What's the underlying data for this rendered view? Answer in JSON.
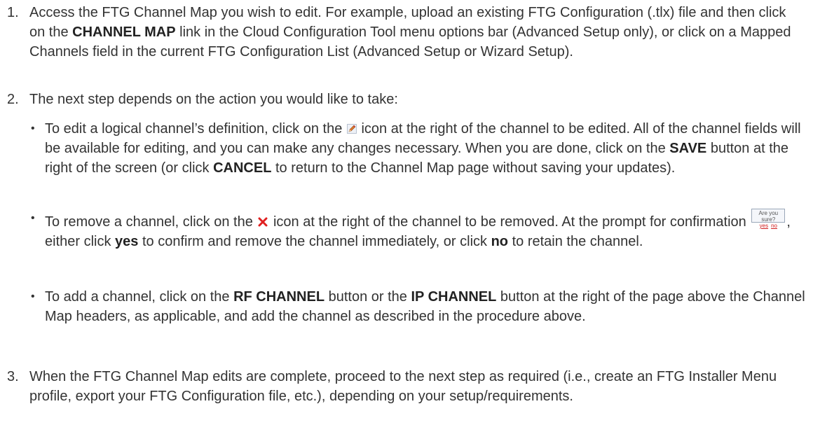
{
  "steps": [
    {
      "number": "1.",
      "parts": {
        "t1": "Access the FTG Channel Map you wish to edit. For example, upload an existing FTG Configuration (.tlx) file and then click on the ",
        "b1": "CHANNEL MAP",
        "t2": " link in the Cloud Configuration Tool menu options bar (Advanced Setup only), or click on a Mapped Channels field in the current FTG Configuration List (Advanced Setup or Wizard Setup)."
      }
    },
    {
      "number": "2.",
      "text": "The next step depends on the action you would like to take:"
    },
    {
      "number": "3.",
      "text": "When the FTG Channel Map edits are complete, proceed to the next step as required (i.e., create an FTG Installer Menu profile, export your FTG Configuration file, etc.), depending on your setup/requirements."
    }
  ],
  "bullets": {
    "dot": "•",
    "edit": {
      "t1": "To edit a logical channel’s definition, click on the ",
      "icon": "edit-pencil-icon",
      "t2": " icon at the right of the channel to be edited. All of the channel fields will be available for editing, and you can make any changes necessary. When you are done, click on the ",
      "b1": "SAVE",
      "t3": " button at the right of the screen (or click ",
      "b2": "CANCEL",
      "t4": " to return to the Channel Map page without saving your updates)."
    },
    "remove": {
      "t1": "To remove a channel, click on the ",
      "icon": "remove-x-icon",
      "t2": " icon at the right of the channel to be removed. At the prompt for confirmation ",
      "confirm": {
        "question": "Are you sure?",
        "yes": "yes",
        "no": "no"
      },
      "t3": ", either click ",
      "b1": "yes",
      "t4": " to confirm and remove the channel immediately, or click ",
      "b2": "no",
      "t5": " to retain the channel."
    },
    "add": {
      "t1": "To add a channel, click on the ",
      "b1": "RF CHANNEL",
      "t2": " button or the ",
      "b2": "IP CHANNEL",
      "t3": " button at the right of the page above the Channel Map headers, as applicable, and add the channel as described in the procedure above."
    }
  },
  "colors": {
    "text": "#333333",
    "link_red": "#d01c1c",
    "icon_red": "#e02020"
  }
}
